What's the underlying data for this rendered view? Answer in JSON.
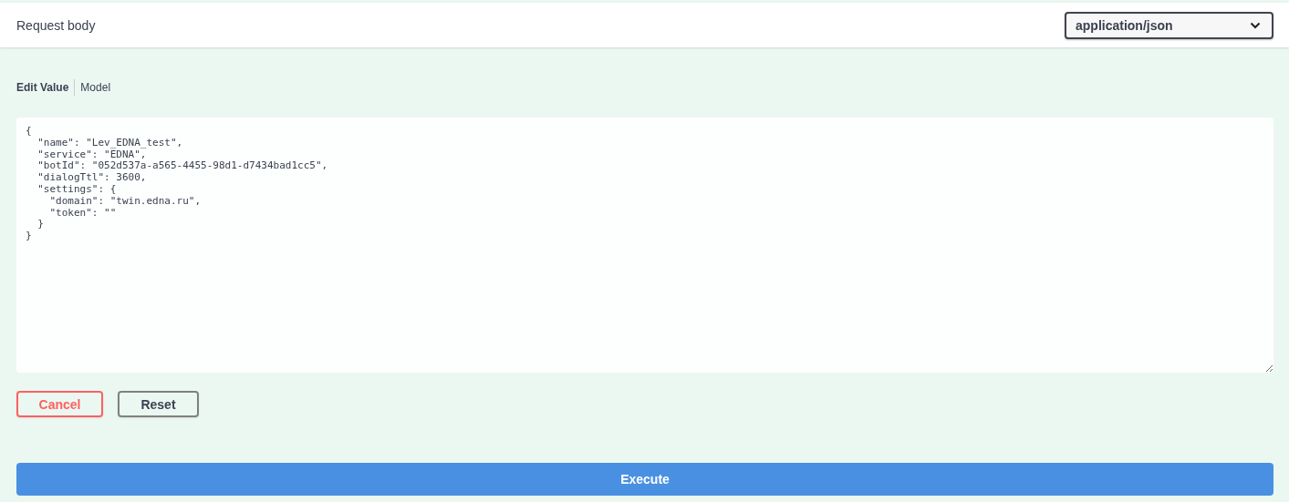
{
  "header": {
    "title": "Request body",
    "content_type": "application/json"
  },
  "tabs": [
    {
      "label": "Edit Value",
      "selected": true
    },
    {
      "label": "Model",
      "selected": false
    }
  ],
  "editor": {
    "value": "{\n  \"name\": \"Lev_EDNA_test\",\n  \"service\": \"EDNA\",\n  \"botId\": \"052d537a-a565-4455-98d1-d7434bad1cc5\",\n  \"dialogTtl\": 3600,\n  \"settings\": {\n    \"domain\": \"twin.edna.ru\",\n    \"token\": \"\"\n  }\n}"
  },
  "buttons": [
    {
      "label": "Cancel",
      "kind": "cancel"
    },
    {
      "label": "Reset",
      "kind": "reset"
    }
  ],
  "execute": {
    "label": "Execute"
  }
}
